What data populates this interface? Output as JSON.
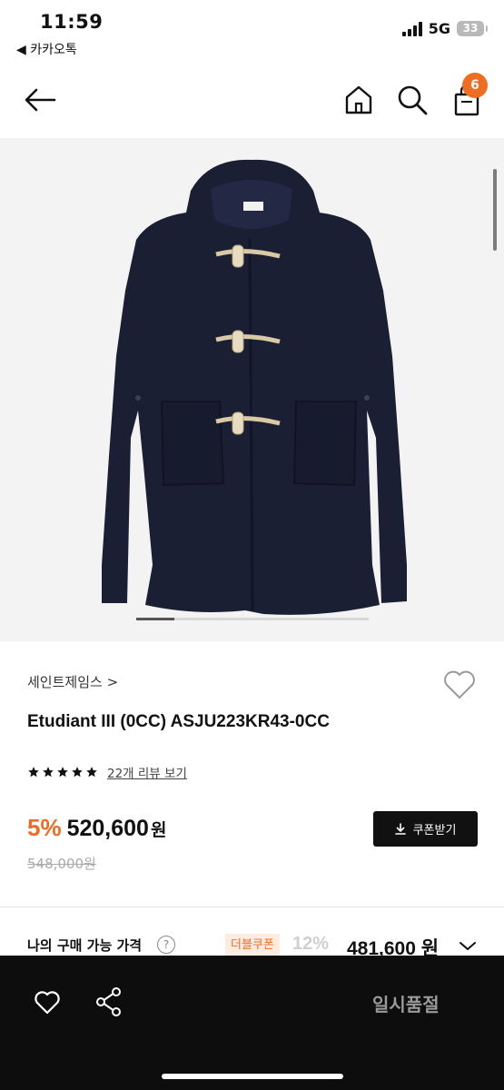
{
  "status_bar": {
    "time": "11:59",
    "back_app": "◀ 카카오톡",
    "network": "5G",
    "battery": "33"
  },
  "nav": {
    "bag_count": "6"
  },
  "product": {
    "brand": "세인트제임스 >",
    "name": "Etudiant III (0CC) ASJU223KR43-0CC",
    "rating_stars": 5,
    "review_link": "22개 리뷰 보기",
    "discount": "5%",
    "price": "520,600",
    "price_unit": "원",
    "original_price": "548,000원",
    "coupon_button": "쿠폰받기"
  },
  "my_price": {
    "label": "나의 구매 가능 가격",
    "help": "?",
    "badge": "더블쿠폰",
    "discount": "12%",
    "price": "481,600 원"
  },
  "bottom_bar": {
    "sold_out": "일시품절"
  },
  "colors": {
    "accent": "#ef6c23",
    "coat": "#1a1f33",
    "toggle": "#d9c9a6"
  }
}
